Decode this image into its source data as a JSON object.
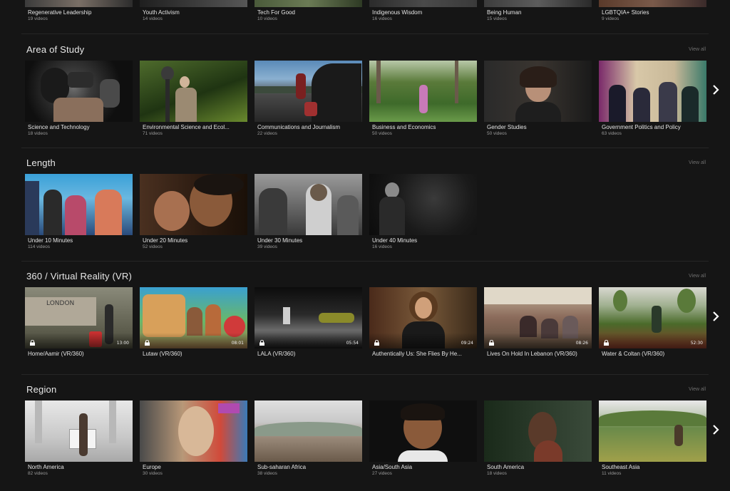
{
  "top_row": [
    {
      "title": "Regenerative Leadership",
      "sub": "19 videos"
    },
    {
      "title": "Youth Activism",
      "sub": "14 videos"
    },
    {
      "title": "Tech For Good",
      "sub": "10 videos"
    },
    {
      "title": "Indigenous Wisdom",
      "sub": "16 videos"
    },
    {
      "title": "Being Human",
      "sub": "15 videos"
    },
    {
      "title": "LGBTQIA+ Stories",
      "sub": "9 videos"
    }
  ],
  "sections": [
    {
      "title": "Area of Study",
      "view_all": "View all",
      "has_next": true,
      "items": [
        {
          "title": "Science and Technology",
          "sub": "18 videos"
        },
        {
          "title": "Environmental Science and Ecol...",
          "sub": "71 videos"
        },
        {
          "title": "Communications and Journalism",
          "sub": "22 videos"
        },
        {
          "title": "Business and Economics",
          "sub": "50 videos"
        },
        {
          "title": "Gender Studies",
          "sub": "50 videos"
        },
        {
          "title": "Government Politics and Policy",
          "sub": "63 videos"
        }
      ]
    },
    {
      "title": "Length",
      "view_all": "View all",
      "has_next": false,
      "items": [
        {
          "title": "Under 10 Minutes",
          "sub": "114 videos"
        },
        {
          "title": "Under 20 Minutes",
          "sub": "52 videos"
        },
        {
          "title": "Under 30 Minutes",
          "sub": "39 videos"
        },
        {
          "title": "Under 40 Minutes",
          "sub": "16 videos"
        }
      ]
    },
    {
      "title": "360 / Virtual Reality (VR)",
      "view_all": "View all",
      "has_next": true,
      "items": [
        {
          "title": "Home/Aamir (VR/360)",
          "duration": "13:00"
        },
        {
          "title": "Lutaw (VR/360)",
          "duration": "08:01"
        },
        {
          "title": "LALA (VR/360)",
          "duration": "05:54"
        },
        {
          "title": "Authentically Us: She Flies By He...",
          "duration": "09:24"
        },
        {
          "title": "Lives On Hold In Lebanon (VR/360)",
          "duration": "08:26"
        },
        {
          "title": "Water & Coltan (VR/360)",
          "duration": "52:30"
        }
      ]
    },
    {
      "title": "Region",
      "view_all": "View all",
      "has_next": true,
      "items": [
        {
          "title": "North America",
          "sub": "82 videos"
        },
        {
          "title": "Europe",
          "sub": "30 videos"
        },
        {
          "title": "Sub-saharan Africa",
          "sub": "38 videos"
        },
        {
          "title": "Asia/South Asia",
          "sub": "27 videos"
        },
        {
          "title": "South America",
          "sub": "18 videos"
        },
        {
          "title": "Southeast Asia",
          "sub": "11 videos"
        }
      ]
    }
  ],
  "icons": {
    "lock": "lock-icon",
    "next": "chevron-right-icon"
  },
  "colors": {
    "background": "#151515",
    "text": "#e6e6e6",
    "muted": "#9a9a9a"
  }
}
